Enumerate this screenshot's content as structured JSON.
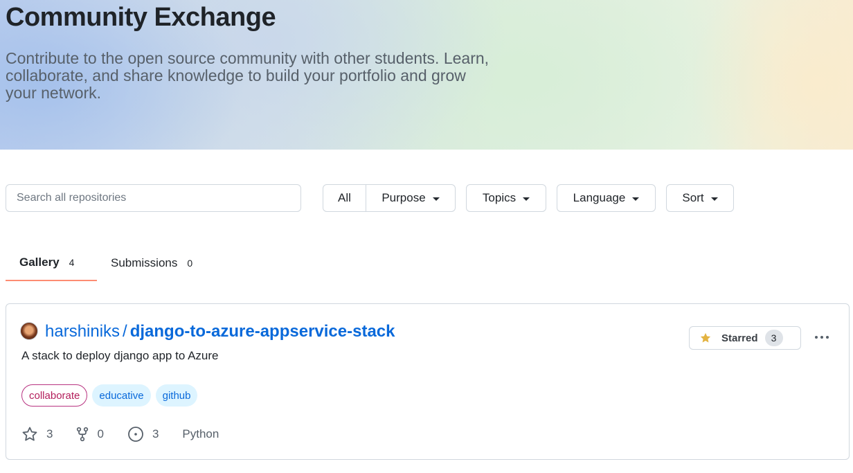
{
  "hero": {
    "title": "Community Exchange",
    "description": "Contribute to the open source community with other students. Learn, collaborate, and share knowledge to build your portfolio and grow your network."
  },
  "search": {
    "placeholder": "Search all repositories",
    "value": ""
  },
  "filters": {
    "all": "All",
    "purpose": "Purpose",
    "topics": "Topics",
    "language": "Language",
    "sort": "Sort"
  },
  "tabs": [
    {
      "label": "Gallery",
      "count": "4",
      "active": true
    },
    {
      "label": "Submissions",
      "count": "0",
      "active": false
    }
  ],
  "repo": {
    "owner": "harshiniks",
    "separator": "/",
    "name": "django-to-azure-appservice-stack",
    "description": "A stack to deploy django app to Azure",
    "topics": [
      "collaborate",
      "educative",
      "github"
    ],
    "stars": "3",
    "forks": "0",
    "issues": "3",
    "language": "Python",
    "star_button": {
      "label": "Starred",
      "count": "3"
    }
  },
  "colors": {
    "link": "#0969da",
    "tab_underline": "#fd8c73",
    "topic_bg": "#ddf4ff",
    "star_icon": "#e3b341"
  },
  "icons": [
    "star-icon",
    "fork-icon",
    "issue-icon",
    "kebab-icon",
    "caret-down-icon"
  ]
}
